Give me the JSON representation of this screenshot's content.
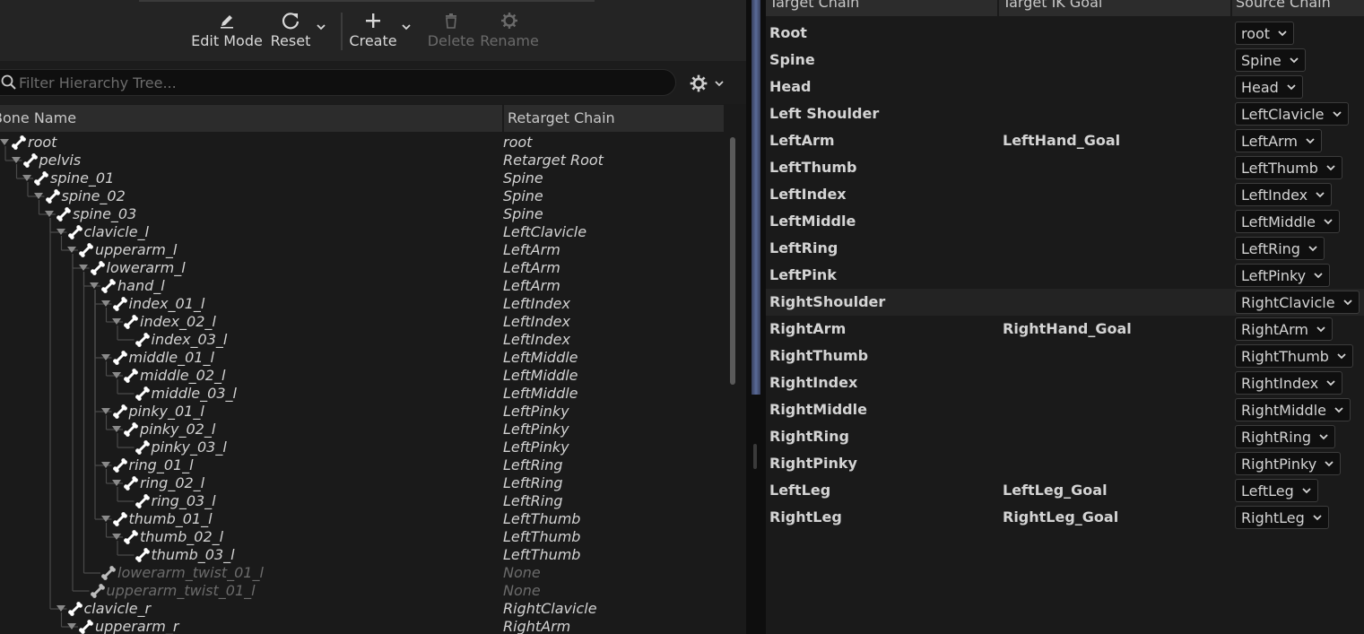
{
  "toolbar": {
    "edit_mode": "Edit Mode",
    "reset": "Reset",
    "create": "Create",
    "delete": "Delete",
    "rename": "Rename"
  },
  "hierarchy": {
    "filter_placeholder": "Filter Hierarchy Tree...",
    "col_bone": "Bone Name",
    "col_chain": "Retarget Chain",
    "rows": [
      {
        "name": "root",
        "chain": "root",
        "depth": 0,
        "expander": true,
        "dim": false
      },
      {
        "name": "pelvis",
        "chain": "Retarget Root",
        "depth": 1,
        "expander": true,
        "dim": false
      },
      {
        "name": "spine_01",
        "chain": "Spine",
        "depth": 2,
        "expander": true,
        "dim": false
      },
      {
        "name": "spine_02",
        "chain": "Spine",
        "depth": 3,
        "expander": true,
        "dim": false
      },
      {
        "name": "spine_03",
        "chain": "Spine",
        "depth": 4,
        "expander": true,
        "dim": false
      },
      {
        "name": "clavicle_l",
        "chain": "LeftClavicle",
        "depth": 5,
        "expander": true,
        "dim": false
      },
      {
        "name": "upperarm_l",
        "chain": "LeftArm",
        "depth": 6,
        "expander": true,
        "dim": false
      },
      {
        "name": "lowerarm_l",
        "chain": "LeftArm",
        "depth": 7,
        "expander": true,
        "dim": false
      },
      {
        "name": "hand_l",
        "chain": "LeftArm",
        "depth": 8,
        "expander": true,
        "dim": false
      },
      {
        "name": "index_01_l",
        "chain": "LeftIndex",
        "depth": 9,
        "expander": true,
        "dim": false
      },
      {
        "name": "index_02_l",
        "chain": "LeftIndex",
        "depth": 10,
        "expander": true,
        "dim": false
      },
      {
        "name": "index_03_l",
        "chain": "LeftIndex",
        "depth": 11,
        "expander": false,
        "dim": false
      },
      {
        "name": "middle_01_l",
        "chain": "LeftMiddle",
        "depth": 9,
        "expander": true,
        "dim": false
      },
      {
        "name": "middle_02_l",
        "chain": "LeftMiddle",
        "depth": 10,
        "expander": true,
        "dim": false
      },
      {
        "name": "middle_03_l",
        "chain": "LeftMiddle",
        "depth": 11,
        "expander": false,
        "dim": false
      },
      {
        "name": "pinky_01_l",
        "chain": "LeftPinky",
        "depth": 9,
        "expander": true,
        "dim": false
      },
      {
        "name": "pinky_02_l",
        "chain": "LeftPinky",
        "depth": 10,
        "expander": true,
        "dim": false
      },
      {
        "name": "pinky_03_l",
        "chain": "LeftPinky",
        "depth": 11,
        "expander": false,
        "dim": false
      },
      {
        "name": "ring_01_l",
        "chain": "LeftRing",
        "depth": 9,
        "expander": true,
        "dim": false
      },
      {
        "name": "ring_02_l",
        "chain": "LeftRing",
        "depth": 10,
        "expander": true,
        "dim": false
      },
      {
        "name": "ring_03_l",
        "chain": "LeftRing",
        "depth": 11,
        "expander": false,
        "dim": false
      },
      {
        "name": "thumb_01_l",
        "chain": "LeftThumb",
        "depth": 9,
        "expander": true,
        "dim": false
      },
      {
        "name": "thumb_02_l",
        "chain": "LeftThumb",
        "depth": 10,
        "expander": true,
        "dim": false
      },
      {
        "name": "thumb_03_l",
        "chain": "LeftThumb",
        "depth": 11,
        "expander": false,
        "dim": false
      },
      {
        "name": "lowerarm_twist_01_l",
        "chain": "None",
        "depth": 8,
        "expander": false,
        "dim": true
      },
      {
        "name": "upperarm_twist_01_l",
        "chain": "None",
        "depth": 7,
        "expander": false,
        "dim": true
      },
      {
        "name": "clavicle_r",
        "chain": "RightClavicle",
        "depth": 5,
        "expander": true,
        "dim": false
      },
      {
        "name": "upperarm_r",
        "chain": "RightArm",
        "depth": 6,
        "expander": true,
        "dim": false
      }
    ]
  },
  "chains": {
    "col_target": "Target Chain",
    "col_goal": "Target IK Goal",
    "col_source": "Source Chain",
    "rows": [
      {
        "target": "Root",
        "goal": "",
        "source": "root"
      },
      {
        "target": "Spine",
        "goal": "",
        "source": "Spine"
      },
      {
        "target": "Head",
        "goal": "",
        "source": "Head"
      },
      {
        "target": "Left Shoulder",
        "goal": "",
        "source": "LeftClavicle"
      },
      {
        "target": "LeftArm",
        "goal": "LeftHand_Goal",
        "source": "LeftArm"
      },
      {
        "target": "LeftThumb",
        "goal": "",
        "source": "LeftThumb"
      },
      {
        "target": "LeftIndex",
        "goal": "",
        "source": "LeftIndex"
      },
      {
        "target": "LeftMiddle",
        "goal": "",
        "source": "LeftMiddle"
      },
      {
        "target": "LeftRing",
        "goal": "",
        "source": "LeftRing"
      },
      {
        "target": "LeftPink",
        "goal": "",
        "source": "LeftPinky"
      },
      {
        "target": "RightShoulder",
        "goal": "",
        "source": "RightClavicle"
      },
      {
        "target": "RightArm",
        "goal": "RightHand_Goal",
        "source": "RightArm"
      },
      {
        "target": "RightThumb",
        "goal": "",
        "source": "RightThumb"
      },
      {
        "target": "RightIndex",
        "goal": "",
        "source": "RightIndex"
      },
      {
        "target": "RightMiddle",
        "goal": "",
        "source": "RightMiddle"
      },
      {
        "target": "RightRing",
        "goal": "",
        "source": "RightRing"
      },
      {
        "target": "RightPinky",
        "goal": "",
        "source": "RightPinky"
      },
      {
        "target": "LeftLeg",
        "goal": "LeftLeg_Goal",
        "source": "LeftLeg"
      },
      {
        "target": "RightLeg",
        "goal": "RightLeg_Goal",
        "source": "RightLeg"
      }
    ]
  }
}
